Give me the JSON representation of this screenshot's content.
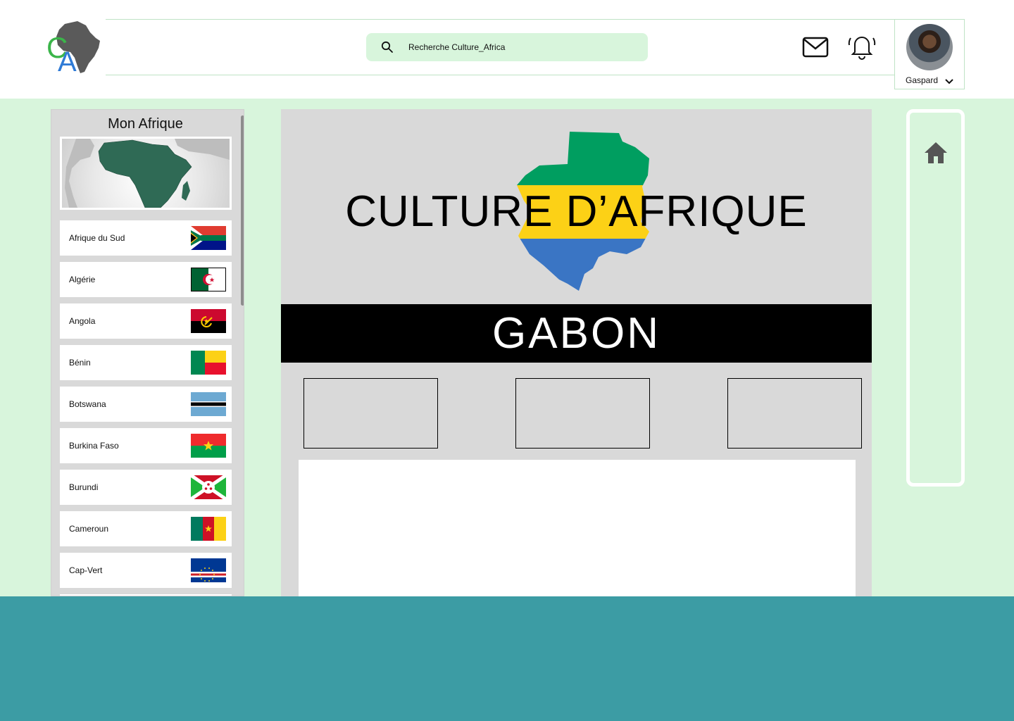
{
  "header": {
    "logo_text": "CA",
    "search_placeholder": "Recherche Culture_Africa",
    "user_name": "Gaspard"
  },
  "sidebar": {
    "title": "Mon Afrique",
    "countries": [
      {
        "label": "Afrique du Sud"
      },
      {
        "label": "Algérie"
      },
      {
        "label": "Angola"
      },
      {
        "label": "Bénin"
      },
      {
        "label": "Botswana"
      },
      {
        "label": "Burkina Faso"
      },
      {
        "label": "Burundi"
      },
      {
        "label": "Cameroun"
      },
      {
        "label": "Cap-Vert"
      }
    ]
  },
  "main": {
    "hero_title": "CULTURE D’AFRIQUE",
    "country_banner": "GABON"
  },
  "colors": {
    "accent_green": "#d8f5dc",
    "footer_teal": "#3c9ca4",
    "content_grey": "#d9d9d9"
  },
  "icons": [
    "search-icon",
    "mail-icon",
    "bell-icon",
    "chevron-down-icon",
    "home-icon"
  ]
}
